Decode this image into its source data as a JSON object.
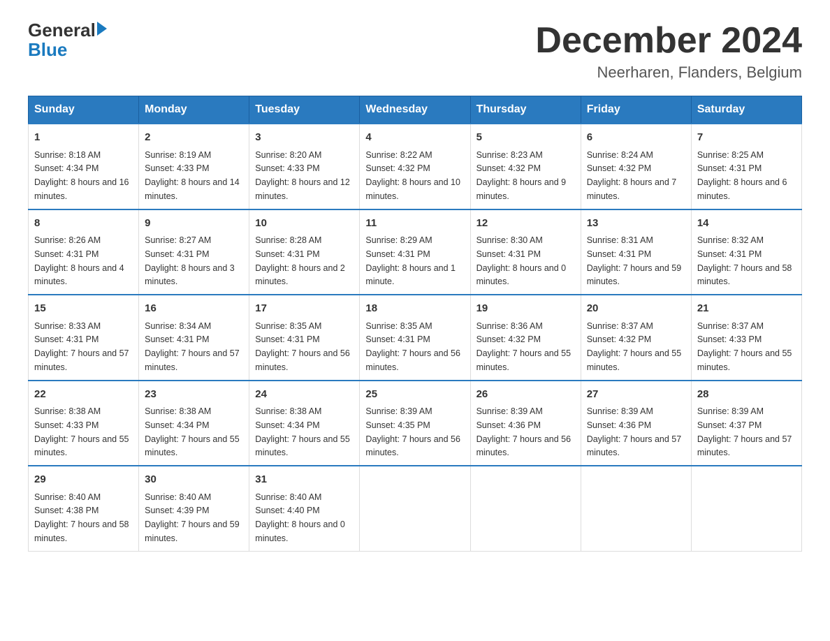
{
  "logo": {
    "general": "General",
    "blue": "Blue",
    "arrow": "▶"
  },
  "header": {
    "month": "December 2024",
    "location": "Neerharen, Flanders, Belgium"
  },
  "days": [
    "Sunday",
    "Monday",
    "Tuesday",
    "Wednesday",
    "Thursday",
    "Friday",
    "Saturday"
  ],
  "weeks": [
    [
      {
        "day": "1",
        "sunrise": "8:18 AM",
        "sunset": "4:34 PM",
        "daylight": "8 hours and 16 minutes."
      },
      {
        "day": "2",
        "sunrise": "8:19 AM",
        "sunset": "4:33 PM",
        "daylight": "8 hours and 14 minutes."
      },
      {
        "day": "3",
        "sunrise": "8:20 AM",
        "sunset": "4:33 PM",
        "daylight": "8 hours and 12 minutes."
      },
      {
        "day": "4",
        "sunrise": "8:22 AM",
        "sunset": "4:32 PM",
        "daylight": "8 hours and 10 minutes."
      },
      {
        "day": "5",
        "sunrise": "8:23 AM",
        "sunset": "4:32 PM",
        "daylight": "8 hours and 9 minutes."
      },
      {
        "day": "6",
        "sunrise": "8:24 AM",
        "sunset": "4:32 PM",
        "daylight": "8 hours and 7 minutes."
      },
      {
        "day": "7",
        "sunrise": "8:25 AM",
        "sunset": "4:31 PM",
        "daylight": "8 hours and 6 minutes."
      }
    ],
    [
      {
        "day": "8",
        "sunrise": "8:26 AM",
        "sunset": "4:31 PM",
        "daylight": "8 hours and 4 minutes."
      },
      {
        "day": "9",
        "sunrise": "8:27 AM",
        "sunset": "4:31 PM",
        "daylight": "8 hours and 3 minutes."
      },
      {
        "day": "10",
        "sunrise": "8:28 AM",
        "sunset": "4:31 PM",
        "daylight": "8 hours and 2 minutes."
      },
      {
        "day": "11",
        "sunrise": "8:29 AM",
        "sunset": "4:31 PM",
        "daylight": "8 hours and 1 minute."
      },
      {
        "day": "12",
        "sunrise": "8:30 AM",
        "sunset": "4:31 PM",
        "daylight": "8 hours and 0 minutes."
      },
      {
        "day": "13",
        "sunrise": "8:31 AM",
        "sunset": "4:31 PM",
        "daylight": "7 hours and 59 minutes."
      },
      {
        "day": "14",
        "sunrise": "8:32 AM",
        "sunset": "4:31 PM",
        "daylight": "7 hours and 58 minutes."
      }
    ],
    [
      {
        "day": "15",
        "sunrise": "8:33 AM",
        "sunset": "4:31 PM",
        "daylight": "7 hours and 57 minutes."
      },
      {
        "day": "16",
        "sunrise": "8:34 AM",
        "sunset": "4:31 PM",
        "daylight": "7 hours and 57 minutes."
      },
      {
        "day": "17",
        "sunrise": "8:35 AM",
        "sunset": "4:31 PM",
        "daylight": "7 hours and 56 minutes."
      },
      {
        "day": "18",
        "sunrise": "8:35 AM",
        "sunset": "4:31 PM",
        "daylight": "7 hours and 56 minutes."
      },
      {
        "day": "19",
        "sunrise": "8:36 AM",
        "sunset": "4:32 PM",
        "daylight": "7 hours and 55 minutes."
      },
      {
        "day": "20",
        "sunrise": "8:37 AM",
        "sunset": "4:32 PM",
        "daylight": "7 hours and 55 minutes."
      },
      {
        "day": "21",
        "sunrise": "8:37 AM",
        "sunset": "4:33 PM",
        "daylight": "7 hours and 55 minutes."
      }
    ],
    [
      {
        "day": "22",
        "sunrise": "8:38 AM",
        "sunset": "4:33 PM",
        "daylight": "7 hours and 55 minutes."
      },
      {
        "day": "23",
        "sunrise": "8:38 AM",
        "sunset": "4:34 PM",
        "daylight": "7 hours and 55 minutes."
      },
      {
        "day": "24",
        "sunrise": "8:38 AM",
        "sunset": "4:34 PM",
        "daylight": "7 hours and 55 minutes."
      },
      {
        "day": "25",
        "sunrise": "8:39 AM",
        "sunset": "4:35 PM",
        "daylight": "7 hours and 56 minutes."
      },
      {
        "day": "26",
        "sunrise": "8:39 AM",
        "sunset": "4:36 PM",
        "daylight": "7 hours and 56 minutes."
      },
      {
        "day": "27",
        "sunrise": "8:39 AM",
        "sunset": "4:36 PM",
        "daylight": "7 hours and 57 minutes."
      },
      {
        "day": "28",
        "sunrise": "8:39 AM",
        "sunset": "4:37 PM",
        "daylight": "7 hours and 57 minutes."
      }
    ],
    [
      {
        "day": "29",
        "sunrise": "8:40 AM",
        "sunset": "4:38 PM",
        "daylight": "7 hours and 58 minutes."
      },
      {
        "day": "30",
        "sunrise": "8:40 AM",
        "sunset": "4:39 PM",
        "daylight": "7 hours and 59 minutes."
      },
      {
        "day": "31",
        "sunrise": "8:40 AM",
        "sunset": "4:40 PM",
        "daylight": "8 hours and 0 minutes."
      },
      null,
      null,
      null,
      null
    ]
  ]
}
